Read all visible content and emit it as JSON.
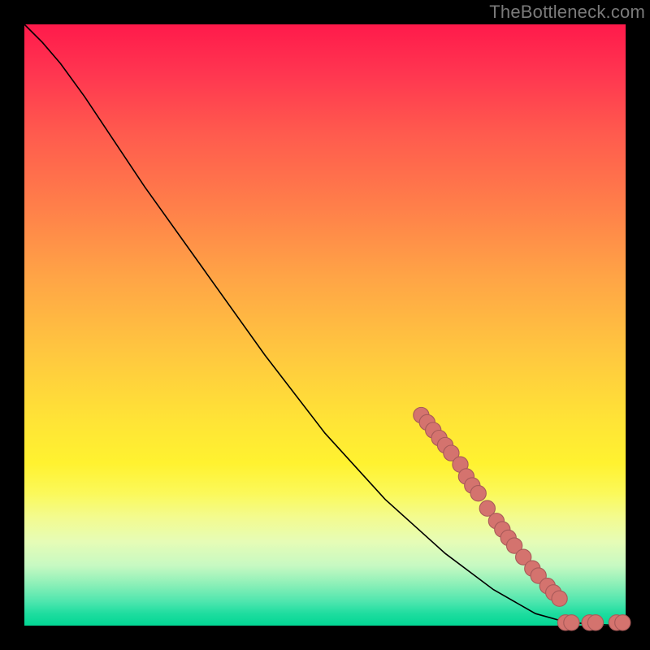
{
  "attribution": "TheBottleneck.com",
  "colors": {
    "background": "#000000",
    "curve": "#000000",
    "dot_fill": "#d4736e",
    "dot_stroke": "#a85a59"
  },
  "chart_data": {
    "type": "line",
    "title": "",
    "xlabel": "",
    "ylabel": "",
    "xlim": [
      0,
      100
    ],
    "ylim": [
      0,
      100
    ],
    "curve_points": [
      {
        "x": 0,
        "y": 100
      },
      {
        "x": 3,
        "y": 97
      },
      {
        "x": 6,
        "y": 93.5
      },
      {
        "x": 10,
        "y": 88
      },
      {
        "x": 15,
        "y": 80.5
      },
      {
        "x": 20,
        "y": 73
      },
      {
        "x": 30,
        "y": 59
      },
      {
        "x": 40,
        "y": 45
      },
      {
        "x": 50,
        "y": 32
      },
      {
        "x": 60,
        "y": 21
      },
      {
        "x": 70,
        "y": 12
      },
      {
        "x": 78,
        "y": 6
      },
      {
        "x": 85,
        "y": 2
      },
      {
        "x": 90,
        "y": 0.6
      },
      {
        "x": 95,
        "y": 0.2
      },
      {
        "x": 100,
        "y": 0
      }
    ],
    "dot_points": [
      {
        "x": 66,
        "y": 35
      },
      {
        "x": 67,
        "y": 33.8
      },
      {
        "x": 68,
        "y": 32.5
      },
      {
        "x": 69,
        "y": 31.2
      },
      {
        "x": 70,
        "y": 30
      },
      {
        "x": 71,
        "y": 28.7
      },
      {
        "x": 72.5,
        "y": 26.8
      },
      {
        "x": 73.5,
        "y": 24.8
      },
      {
        "x": 74.5,
        "y": 23.3
      },
      {
        "x": 75.5,
        "y": 22
      },
      {
        "x": 77,
        "y": 19.5
      },
      {
        "x": 78.5,
        "y": 17.4
      },
      {
        "x": 79.5,
        "y": 16
      },
      {
        "x": 80.5,
        "y": 14.6
      },
      {
        "x": 81.5,
        "y": 13.3
      },
      {
        "x": 83,
        "y": 11.4
      },
      {
        "x": 84.5,
        "y": 9.5
      },
      {
        "x": 85.5,
        "y": 8.3
      },
      {
        "x": 87,
        "y": 6.6
      },
      {
        "x": 88,
        "y": 5.5
      },
      {
        "x": 89,
        "y": 4.5
      },
      {
        "x": 90,
        "y": 0.5
      },
      {
        "x": 91,
        "y": 0.5
      },
      {
        "x": 94,
        "y": 0.5
      },
      {
        "x": 95,
        "y": 0.5
      },
      {
        "x": 98.5,
        "y": 0.5
      },
      {
        "x": 99.5,
        "y": 0.5
      }
    ]
  }
}
